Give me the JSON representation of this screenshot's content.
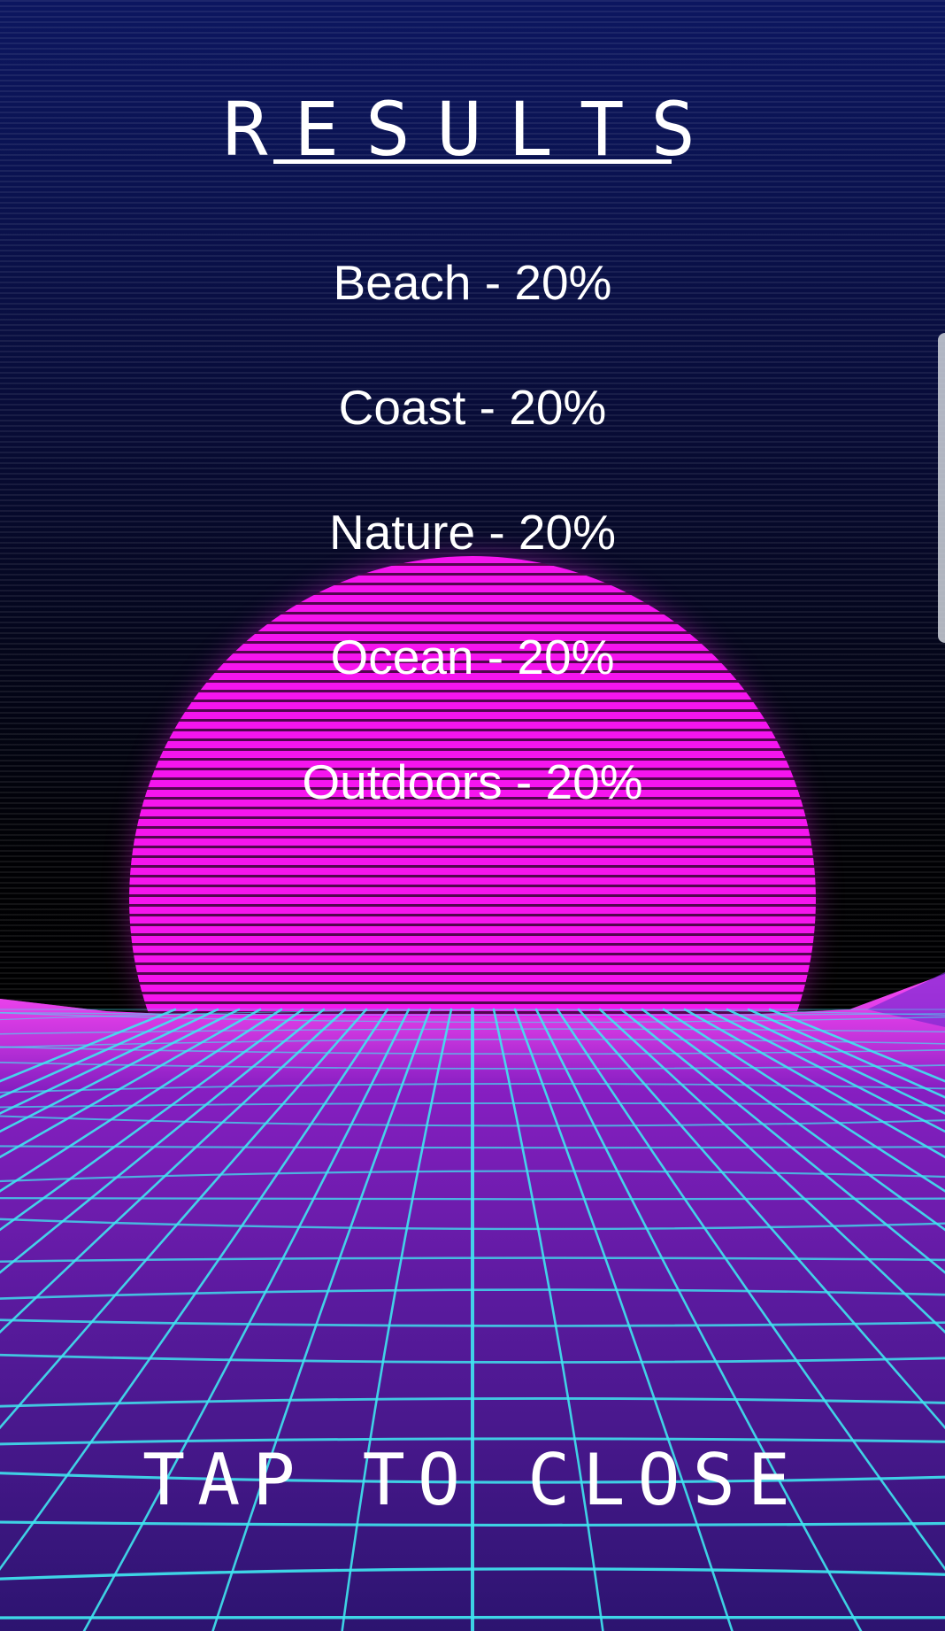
{
  "title": "RESULTS",
  "results": [
    {
      "label": "Beach - 20%"
    },
    {
      "label": "Coast - 20%"
    },
    {
      "label": "Nature - 20%"
    },
    {
      "label": "Ocean - 20%"
    },
    {
      "label": "Outdoors - 20%"
    }
  ],
  "close_label": "TAP TO CLOSE",
  "colors": {
    "sky_top": "#0c1660",
    "sun": "#f515ee",
    "grid_line": "#3fe6f0",
    "floor": "#6a1aa8",
    "text": "#ffffff"
  }
}
